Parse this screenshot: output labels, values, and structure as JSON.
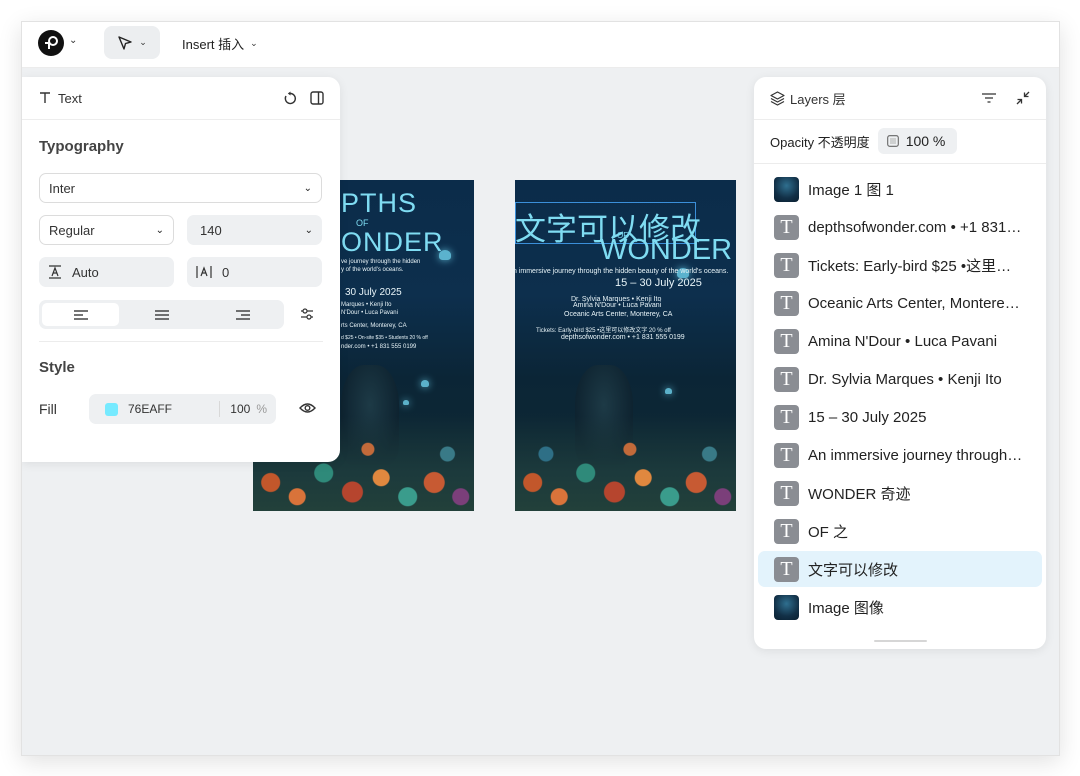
{
  "toolbar": {
    "insert_label": "Insert 插入"
  },
  "text_panel": {
    "title": "Text",
    "typography_label": "Typography",
    "font_family": "Inter",
    "font_weight": "Regular",
    "font_size": "140",
    "line_height": "Auto",
    "letter_spacing": "0",
    "style_label": "Style",
    "fill_label": "Fill",
    "fill_hex": "76EAFF",
    "fill_color": "#76EAFF",
    "fill_opacity": "100",
    "percent_sign": "%"
  },
  "layers_panel": {
    "title": "Layers 层",
    "opacity_label": "Opacity 不透明度",
    "opacity_value": "100 %",
    "items": [
      {
        "label": "Image 1 图 1",
        "kind": "image"
      },
      {
        "label": "depthsofwonder.com • +1 831 555 0199",
        "kind": "text"
      },
      {
        "label": "Tickets: Early-bird $25 •这里可以修改文字 20 % off",
        "kind": "text"
      },
      {
        "label": "Oceanic Arts Center, Monterey, CA",
        "kind": "text"
      },
      {
        "label": "Amina N'Dour • Luca Pavani",
        "kind": "text"
      },
      {
        "label": "Dr. Sylvia Marques • Kenji Ito",
        "kind": "text"
      },
      {
        "label": "15 – 30 July 2025",
        "kind": "text"
      },
      {
        "label": "An immersive journey through the hidden beauty of the world's oceans.",
        "kind": "text"
      },
      {
        "label": "WONDER 奇迹",
        "kind": "text"
      },
      {
        "label": "OF 之",
        "kind": "text"
      },
      {
        "label": "文字可以修改",
        "kind": "text",
        "selected": true
      },
      {
        "label": "Image 图像",
        "kind": "image"
      }
    ]
  },
  "poster_left": {
    "title_line1": "PTHS",
    "of": "OF",
    "title_line2": "ONDER",
    "tagline_1": "ve journey through the hidden",
    "tagline_2": "y of the world's oceans.",
    "dates": "30 July 2025",
    "speakers_1": "Marques • Kenji Ito",
    "speakers_2": "N'Dour • Luca Pavani",
    "venue": "rts Center, Monterey, CA",
    "tickets": "d $25 • On-site $35 • Students 20 % off",
    "contact": "nder.com • +1 831 555 0199"
  },
  "poster_right": {
    "edited_text": "文字可以修改",
    "of": "OF",
    "wonder": "WONDER",
    "tagline": "n immersive journey through the hidden beauty of the world's oceans.",
    "dates": "15 – 30 July 2025",
    "speakers_1": "Dr. Sylvia Marques • Kenji Ito",
    "speakers_2": "Amina N'Dour • Luca Pavani",
    "venue": "Oceanic Arts Center, Monterey, CA",
    "tickets": "Tickets: Early-bird $25 •这里可以修改文字 20 % off",
    "contact": "depthsofwonder.com • +1 831 555 0199"
  }
}
